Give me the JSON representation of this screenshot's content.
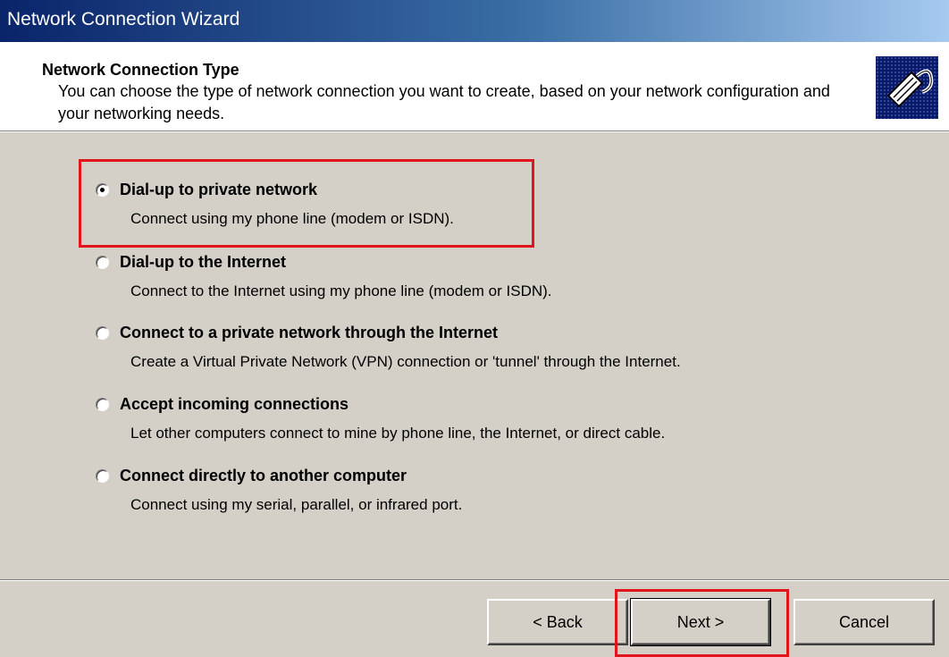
{
  "window": {
    "title": "Network Connection Wizard"
  },
  "header": {
    "title": "Network Connection Type",
    "description": "You can choose the type of network connection you want to create, based on your network configuration and your networking needs.",
    "icon": "network-cable-icon"
  },
  "options": [
    {
      "label": "Dial-up to private network",
      "description": "Connect using my phone line (modem or ISDN).",
      "selected": true
    },
    {
      "label": "Dial-up to the Internet",
      "description": "Connect to the Internet using my phone line (modem or ISDN).",
      "selected": false
    },
    {
      "label": "Connect to a private network through the Internet",
      "description": "Create a Virtual Private Network (VPN) connection or 'tunnel' through the Internet.",
      "selected": false
    },
    {
      "label": "Accept incoming connections",
      "description": "Let other computers connect to mine by phone line, the Internet, or direct cable.",
      "selected": false
    },
    {
      "label": "Connect directly to another computer",
      "description": "Connect using my serial, parallel, or infrared port.",
      "selected": false
    }
  ],
  "buttons": {
    "back": "< Back",
    "next": "Next >",
    "cancel": "Cancel"
  },
  "colors": {
    "highlight": "#e1161c",
    "face": "#d4d0c8",
    "titlebar_start": "#0a246a",
    "titlebar_end": "#a6caf0"
  }
}
